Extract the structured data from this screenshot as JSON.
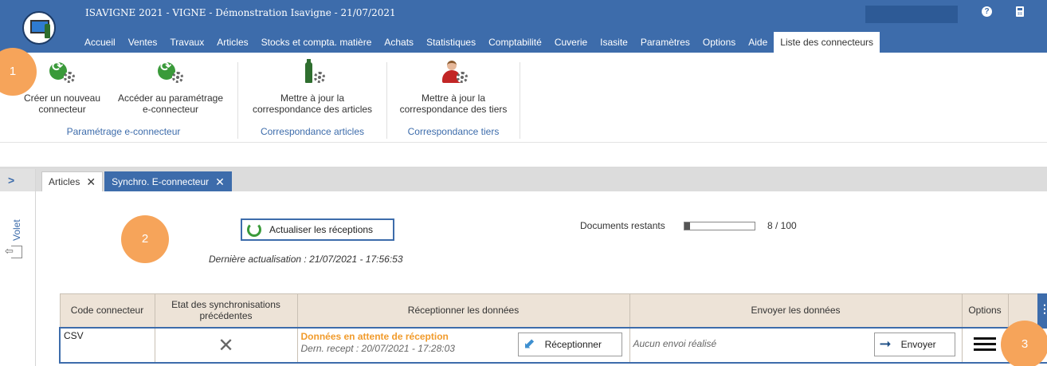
{
  "window": {
    "title": "ISAVIGNE 2021 - VIGNE - Démonstration Isavigne - 21/07/2021",
    "help_glyph": "?"
  },
  "menu": [
    {
      "label": "Accueil"
    },
    {
      "label": "Ventes"
    },
    {
      "label": "Travaux"
    },
    {
      "label": "Articles"
    },
    {
      "label": "Stocks et compta. matière"
    },
    {
      "label": "Achats"
    },
    {
      "label": "Statistiques"
    },
    {
      "label": "Comptabilité"
    },
    {
      "label": "Cuverie"
    },
    {
      "label": "Isasite"
    },
    {
      "label": "Paramètres"
    },
    {
      "label": "Options"
    },
    {
      "label": "Aide"
    },
    {
      "label": "Liste des connecteurs",
      "active": true
    }
  ],
  "ribbon": {
    "groups": [
      {
        "label": "Paramétrage e-connecteur",
        "buttons": [
          {
            "line1": "Créer un nouveau",
            "line2": "connecteur",
            "icon": "refresh-gear-icon"
          },
          {
            "line1": "Accéder au paramétrage",
            "line2": "e-connecteur",
            "icon": "refresh-gear-icon"
          }
        ]
      },
      {
        "label": "Correspondance articles",
        "buttons": [
          {
            "line1": "Mettre à jour la",
            "line2": "correspondance des articles",
            "icon": "bottle-gear-icon"
          }
        ]
      },
      {
        "label": "Correspondance tiers",
        "buttons": [
          {
            "line1": "Mettre à jour la",
            "line2": "correspondance des tiers",
            "icon": "person-gear-icon"
          }
        ]
      }
    ]
  },
  "side_panel": {
    "expand_glyph": ">",
    "label": "Volet"
  },
  "tabs": [
    {
      "label": "Articles",
      "close": "✕"
    },
    {
      "label": "Synchro. E-connecteur",
      "close": "✕",
      "active": true
    }
  ],
  "badges": [
    "1",
    "2",
    "3"
  ],
  "sync": {
    "refresh_button": "Actualiser les réceptions",
    "last_update": "Dernière actualisation : 21/07/2021 - 17:56:53",
    "docs_label": "Documents restants",
    "docs_progress": 0.08,
    "docs_count": "8 / 100"
  },
  "table": {
    "headers": {
      "code": "Code connecteur",
      "state_line1": "Etat des synchronisations",
      "state_line2": "précédentes",
      "receive": "Réceptionner les données",
      "send": "Envoyer les données",
      "options": "Options"
    },
    "rows": [
      {
        "code": "CSV",
        "state_glyph": "✕",
        "receive_status": "Données en attente de réception",
        "receive_last": "Dern. recept : 20/07/2021 - 17:28:03",
        "receive_button": "Réceptionner",
        "send_status": "Aucun envoi réalisé",
        "send_button": "Envoyer"
      }
    ]
  },
  "colors": {
    "brand_blue": "#3d6cab",
    "accent_orange": "#f6a45a",
    "status_orange": "#f19b2c",
    "header_beige": "#ede3d7"
  }
}
